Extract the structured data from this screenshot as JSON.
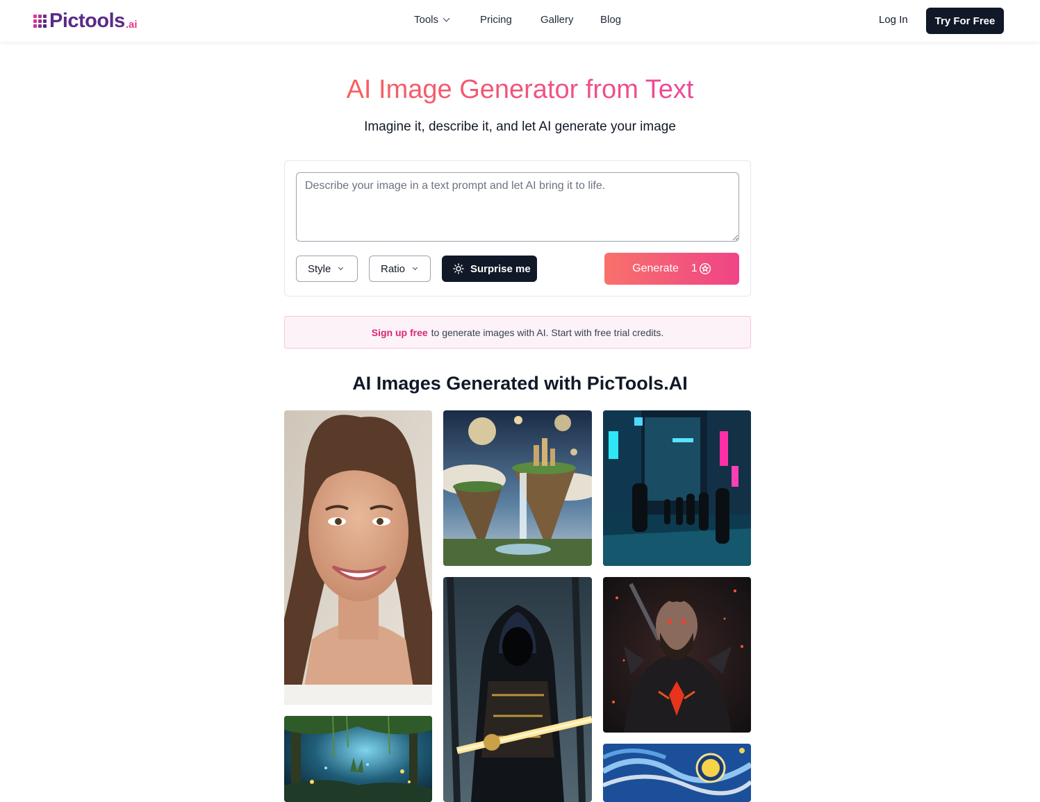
{
  "header": {
    "logo_text": "Pictools",
    "logo_suffix": ".ai",
    "nav": [
      {
        "label": "Tools",
        "has_dropdown": true
      },
      {
        "label": "Pricing"
      },
      {
        "label": "Gallery"
      },
      {
        "label": "Blog"
      }
    ],
    "login_label": "Log In",
    "cta_label": "Try For Free"
  },
  "hero": {
    "title": "AI Image Generator from Text",
    "subtitle": "Imagine it, describe it, and let AI generate your image"
  },
  "generator": {
    "prompt_placeholder": "Describe your image in a text prompt and let AI bring it to life.",
    "prompt_value": "",
    "style_label": "Style",
    "ratio_label": "Ratio",
    "surprise_label": "Surprise me",
    "generate_label": "Generate",
    "generate_cost": "1"
  },
  "banner": {
    "link_text": "Sign up free",
    "text": "to generate images with AI. Start with free trial credits."
  },
  "gallery": {
    "title": "AI Images Generated with PicTools.AI",
    "images": [
      {
        "subject": "smiling woman portrait"
      },
      {
        "subject": "floating island castle waterfall"
      },
      {
        "subject": "cyberpunk neon street soldiers"
      },
      {
        "subject": "hooded dark knight golden sword"
      },
      {
        "subject": "armored warrior glowing red"
      },
      {
        "subject": "enchanted jungle fireflies"
      },
      {
        "subject": "starry night swirl painting"
      }
    ]
  },
  "colors": {
    "brand_purple": "#5b2a86",
    "brand_pink": "#e5398b",
    "gradient_start": "#f8605f",
    "gradient_end": "#ec4899",
    "dark_button": "#111827"
  }
}
